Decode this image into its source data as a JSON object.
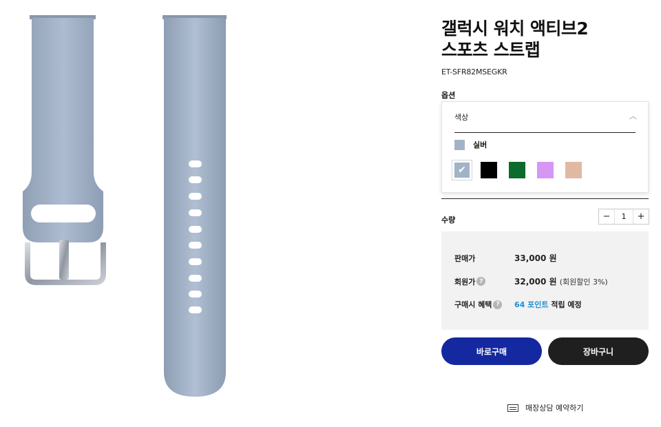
{
  "product": {
    "title_line1": "갤럭시 워치 액티브2",
    "title_line2": "스포츠 스트랩",
    "sku": "ET-SFR82MSEGKR"
  },
  "options": {
    "label": "옵션",
    "dropdown_label": "색상",
    "selected_color_name": "실버",
    "colors": [
      {
        "name": "silver",
        "hex": "#a2b3c8",
        "selected": true
      },
      {
        "name": "black",
        "hex": "#000000",
        "selected": false
      },
      {
        "name": "green",
        "hex": "#0b6b2a",
        "selected": false
      },
      {
        "name": "lavender",
        "hex": "#d796f4",
        "selected": false
      },
      {
        "name": "pink",
        "hex": "#e1b9a2",
        "selected": false
      }
    ]
  },
  "quantity": {
    "label": "수량",
    "minus": "−",
    "value": "1",
    "plus": "+"
  },
  "pricing": {
    "sale_label": "판매가",
    "sale_price": "33,000 원",
    "member_label": "회원가",
    "member_price": "32,000 원",
    "member_discount": "(회원할인 3%)",
    "benefit_label": "구매시 혜택",
    "benefit_points": "64 포인트",
    "benefit_suffix": " 적립 예정",
    "help_glyph": "?"
  },
  "actions": {
    "buy_now": "바로구매",
    "cart": "장바구니",
    "store_reservation": "매장상담 예약하기"
  },
  "colors": {
    "buy_button": "#1428a0",
    "cart_button": "#1f1f1f",
    "point_text": "#1a8fd6",
    "strap": "#a2b3c8"
  }
}
